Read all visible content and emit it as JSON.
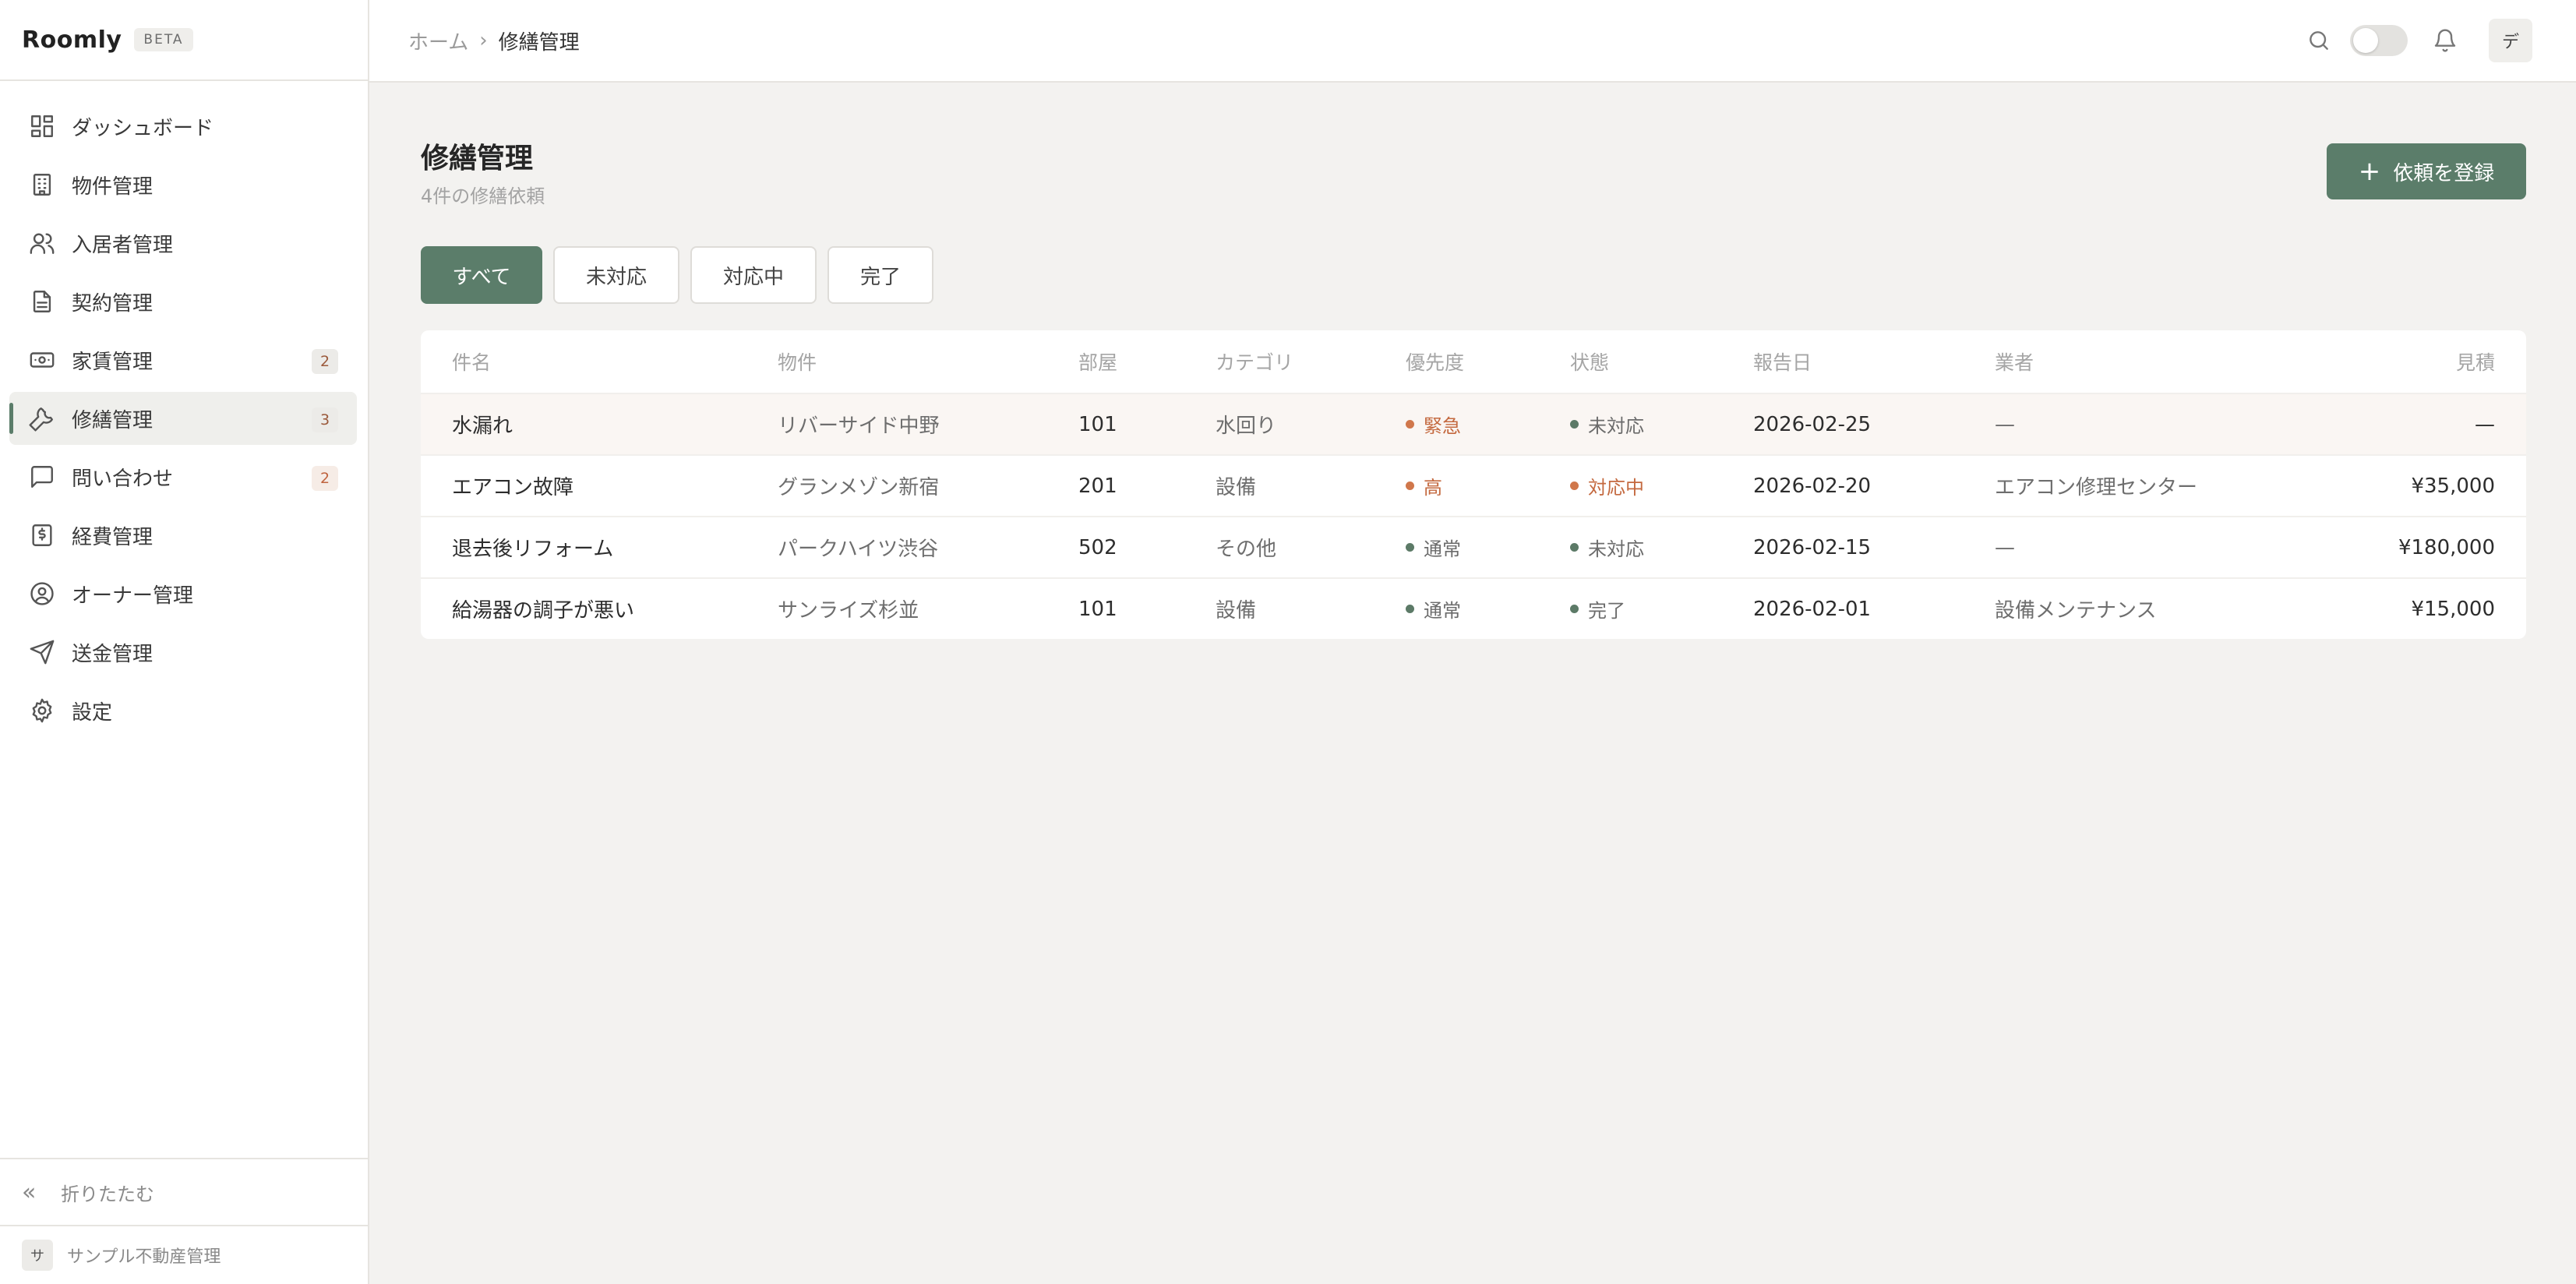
{
  "app": {
    "name": "Roomly",
    "badge": "BETA"
  },
  "sidebar": {
    "items": [
      {
        "label": "ダッシュボード",
        "icon": "dashboard-icon"
      },
      {
        "label": "物件管理",
        "icon": "building-icon"
      },
      {
        "label": "入居者管理",
        "icon": "users-icon"
      },
      {
        "label": "契約管理",
        "icon": "document-icon"
      },
      {
        "label": "家賃管理",
        "icon": "banknote-icon",
        "badge": "2"
      },
      {
        "label": "修繕管理",
        "icon": "wrench-icon",
        "badge": "3",
        "active": true
      },
      {
        "label": "問い合わせ",
        "icon": "message-icon",
        "badge": "2"
      },
      {
        "label": "経費管理",
        "icon": "receipt-icon"
      },
      {
        "label": "オーナー管理",
        "icon": "user-circle-icon"
      },
      {
        "label": "送金管理",
        "icon": "send-icon"
      },
      {
        "label": "設定",
        "icon": "gear-icon"
      }
    ],
    "collapse_label": "折りたたむ",
    "org": {
      "avatar": "サ",
      "name": "サンプル不動産管理"
    }
  },
  "header": {
    "breadcrumb": {
      "home": "ホーム",
      "separator": "›",
      "current": "修繕管理"
    },
    "user_initial": "デ"
  },
  "page": {
    "title": "修繕管理",
    "subtitle": "4件の修繕依頼",
    "add_button": {
      "icon": "+",
      "label": "依頼を登録"
    },
    "filters": [
      {
        "label": "すべて",
        "active": true
      },
      {
        "label": "未対応"
      },
      {
        "label": "対応中"
      },
      {
        "label": "完了"
      }
    ]
  },
  "table": {
    "columns": {
      "title": "件名",
      "property": "物件",
      "room": "部屋",
      "category": "カテゴリ",
      "priority": "優先度",
      "status": "状態",
      "reported": "報告日",
      "vendor": "業者",
      "estimate": "見積"
    },
    "rows": [
      {
        "title": "水漏れ",
        "property": "リバーサイド中野",
        "room": "101",
        "category": "水回り",
        "priority": "緊急",
        "status": "未対応",
        "reported": "2026-02-25",
        "vendor": "—",
        "estimate": "—"
      },
      {
        "title": "エアコン故障",
        "property": "グランメゾン新宿",
        "room": "201",
        "category": "設備",
        "priority": "高",
        "status": "対応中",
        "reported": "2026-02-20",
        "vendor": "エアコン修理センター",
        "estimate": "¥35,000"
      },
      {
        "title": "退去後リフォーム",
        "property": "パークハイツ渋谷",
        "room": "502",
        "category": "その他",
        "priority": "通常",
        "status": "未対応",
        "reported": "2026-02-15",
        "vendor": "—",
        "estimate": "¥180,000"
      },
      {
        "title": "給湯器の調子が悪い",
        "property": "サンライズ杉並",
        "room": "101",
        "category": "設備",
        "priority": "通常",
        "status": "完了",
        "reported": "2026-02-01",
        "vendor": "設備メンテナンス",
        "estimate": "¥15,000"
      }
    ]
  },
  "colors": {
    "accent": "#5b7d6a",
    "warning": "#c4693f",
    "background": "#f3f2f0"
  }
}
